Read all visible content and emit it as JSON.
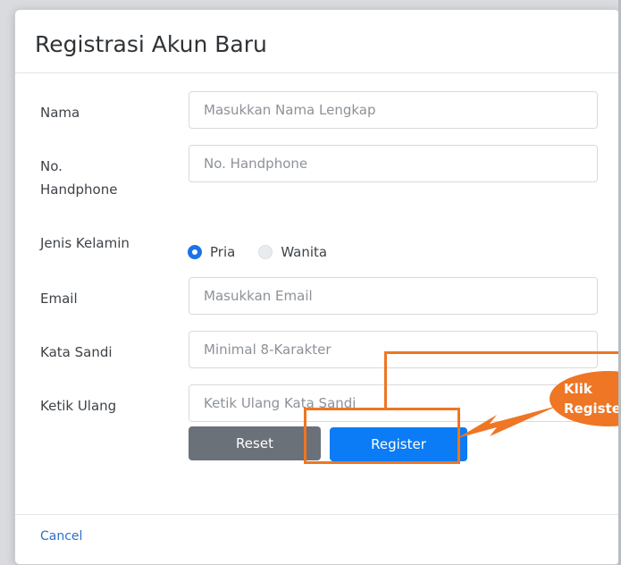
{
  "dialog": {
    "title": "Registrasi Akun Baru",
    "cancel_label": "Cancel"
  },
  "form": {
    "name": {
      "label": "Nama",
      "placeholder": "Masukkan Nama Lengkap"
    },
    "phone": {
      "label_line1": "No.",
      "label_line2": "Handphone",
      "placeholder": "No. Handphone"
    },
    "gender": {
      "label": "Jenis Kelamin",
      "options": [
        {
          "label": "Pria",
          "checked": true
        },
        {
          "label": "Wanita",
          "checked": false
        }
      ]
    },
    "email": {
      "label": "Email",
      "placeholder": "Masukkan Email"
    },
    "password": {
      "label": "Kata Sandi",
      "placeholder": "Minimal 8-Karakter"
    },
    "confirm": {
      "label": "Ketik Ulang",
      "placeholder": "Ketik Ulang Kata Sandi"
    }
  },
  "buttons": {
    "reset_label": "Reset",
    "register_label": "Register"
  },
  "annotation": {
    "line1": "Klik",
    "line2": "Register",
    "color": "#ee7624"
  },
  "colors": {
    "primary": "#0b7cf5",
    "secondary": "#6b7178",
    "link": "#2b71c9"
  }
}
